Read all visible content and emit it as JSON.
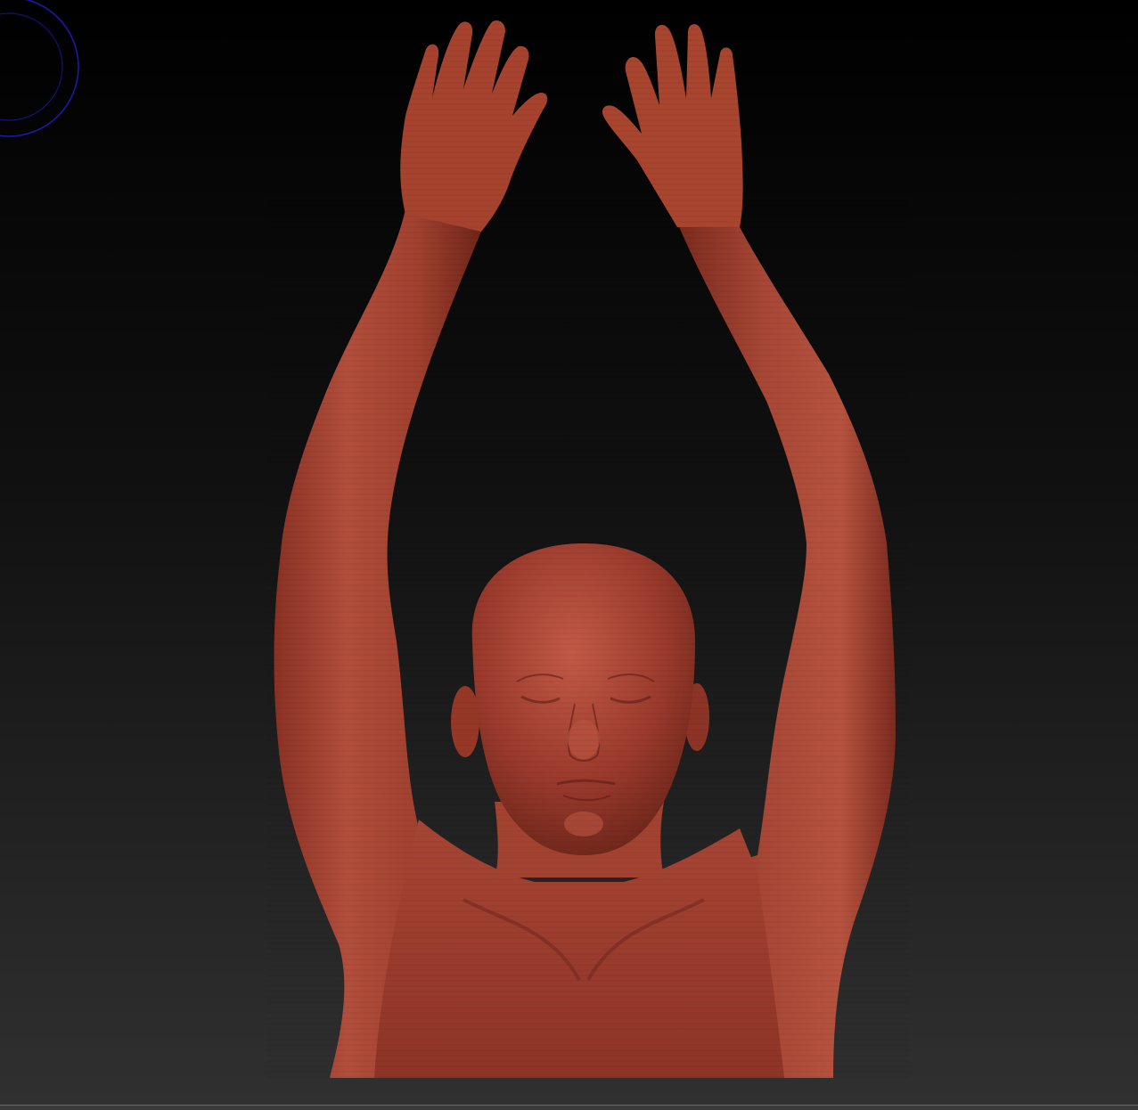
{
  "viewport": {
    "background_top": "#000000",
    "background_bottom": "#2e2e2e"
  },
  "brush": {
    "icon": "brush-cursor-icon",
    "color": "#1a1aa8"
  },
  "model": {
    "icon": "sculpt-model",
    "base_color": "#9a3a2c",
    "highlight_color": "#c9604c",
    "shadow_color": "#5e1e16"
  }
}
